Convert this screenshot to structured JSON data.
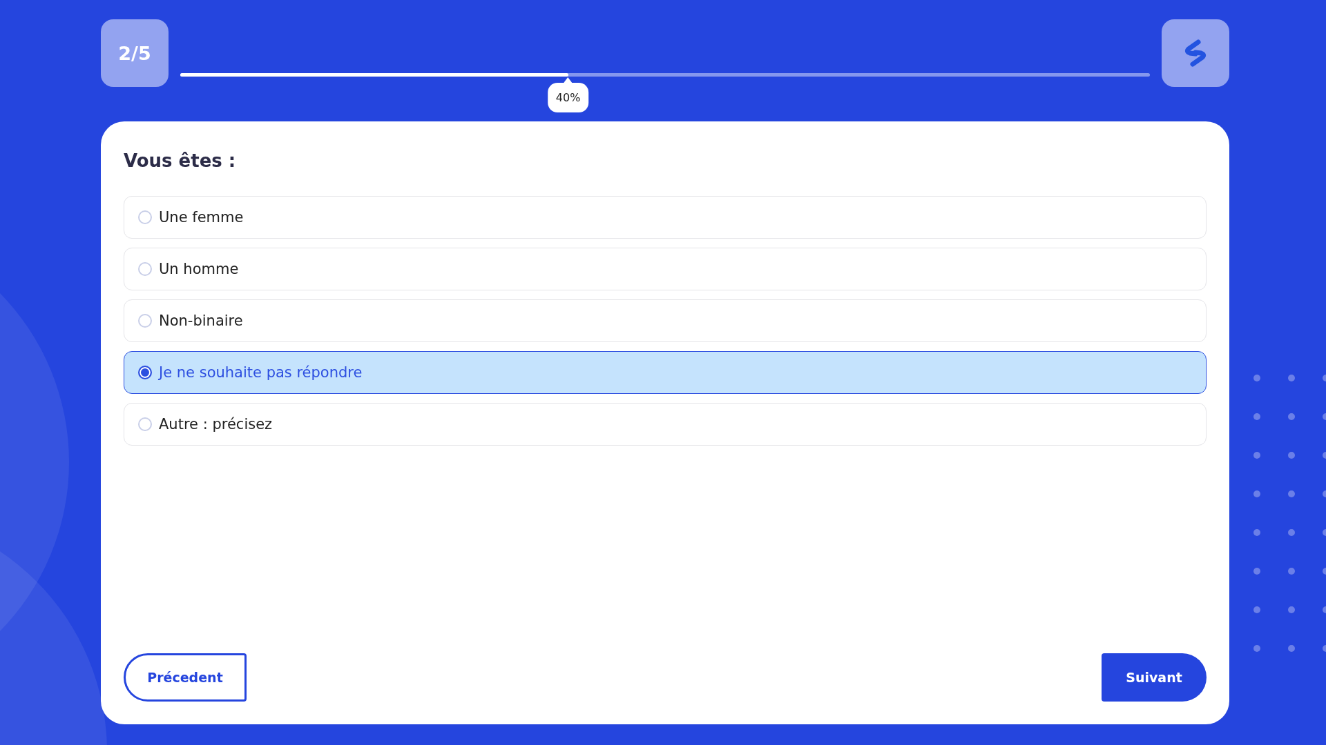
{
  "progress": {
    "step": "2/5",
    "level": 0.4,
    "reading": "40%"
  },
  "question": {
    "title": "Vous êtes :",
    "options": [
      {
        "label": "Une femme",
        "selected": false
      },
      {
        "label": "Un homme",
        "selected": false
      },
      {
        "label": "Non-binaire",
        "selected": false
      },
      {
        "label": "Je ne souhaite pas répondre",
        "selected": true
      },
      {
        "label": "Autre : précisez",
        "selected": false
      }
    ]
  },
  "buttons": [
    {
      "kind": "previous",
      "label": "Précedent"
    },
    {
      "kind": "next",
      "label": "Suivant"
    }
  ]
}
